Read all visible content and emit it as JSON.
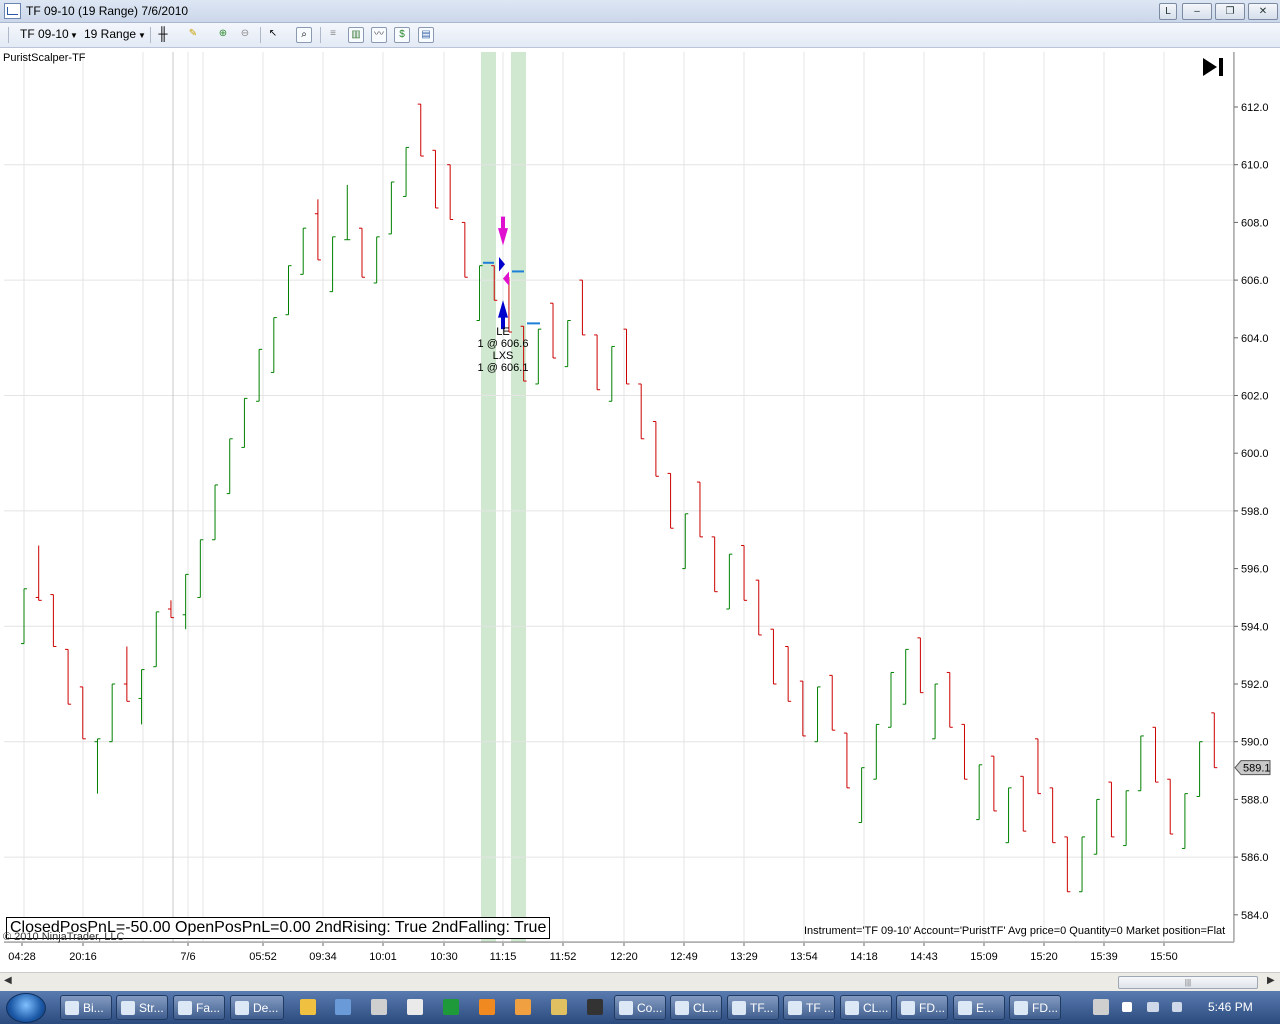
{
  "window": {
    "title": "TF 09-10 (19 Range)  7/6/2010",
    "buttons": [
      "L",
      "–",
      "❐",
      "✕"
    ]
  },
  "toolbar": {
    "instrument": "TF 09-10",
    "period": "19 Range"
  },
  "chart": {
    "panel_label": "PuristScalper-TF",
    "summary": "ClosedPosPnL=-50.00 OpenPosPnL=0.00 2ndRising: True 2ndFalling: True",
    "copyright": "© 2010 NinjaTrader, LLC",
    "instrument_info": "Instrument='TF 09-10' Account='PuristTF' Avg price=0 Quantity=0 Market position=Flat",
    "current_price": "589.1",
    "trade_labels": [
      "LE",
      "1 @ 606.6",
      "LXS",
      "1 @ 606.1"
    ]
  },
  "chart_data": {
    "type": "bar",
    "style": "OHLC range bars",
    "ylim": [
      583.5,
      613.5
    ],
    "y_ticks": [
      "612.0",
      "610.0",
      "608.0",
      "606.0",
      "604.0",
      "602.0",
      "600.0",
      "598.0",
      "596.0",
      "594.0",
      "592.0",
      "590.0",
      "588.0",
      "586.0",
      "584.0"
    ],
    "x_labels": [
      "04:28",
      "20:16",
      "7/6",
      "05:52",
      "09:34",
      "10:01",
      "10:30",
      "11:15",
      "11:52",
      "12:20",
      "12:49",
      "13:29",
      "13:54",
      "14:18",
      "14:43",
      "15:09",
      "15:20",
      "15:39",
      "15:50"
    ],
    "up_color": "#008000",
    "down_color": "#cc0000",
    "bars": [
      {
        "o": 593.4,
        "h": 595.3,
        "l": 593.4,
        "c": 595.3
      },
      {
        "o": 595.0,
        "h": 596.8,
        "l": 594.9,
        "c": 594.9
      },
      {
        "o": 595.1,
        "h": 595.1,
        "l": 593.3,
        "c": 593.3
      },
      {
        "o": 593.2,
        "h": 593.2,
        "l": 591.3,
        "c": 591.3
      },
      {
        "o": 591.9,
        "h": 591.9,
        "l": 590.1,
        "c": 590.1
      },
      {
        "o": 590.0,
        "h": 590.1,
        "l": 588.2,
        "c": 590.1
      },
      {
        "o": 590.0,
        "h": 592.0,
        "l": 590.0,
        "c": 592.0
      },
      {
        "o": 592.0,
        "h": 593.3,
        "l": 591.4,
        "c": 591.4
      },
      {
        "o": 591.5,
        "h": 592.5,
        "l": 590.6,
        "c": 592.5
      },
      {
        "o": 592.6,
        "h": 594.5,
        "l": 592.6,
        "c": 594.5
      },
      {
        "o": 594.6,
        "h": 594.9,
        "l": 594.3,
        "c": 594.3
      },
      {
        "o": 594.4,
        "h": 595.8,
        "l": 593.9,
        "c": 595.8
      },
      {
        "o": 595.0,
        "h": 597.0,
        "l": 595.0,
        "c": 597.0
      },
      {
        "o": 597.0,
        "h": 598.9,
        "l": 597.0,
        "c": 598.9
      },
      {
        "o": 598.6,
        "h": 600.5,
        "l": 598.6,
        "c": 600.5
      },
      {
        "o": 600.2,
        "h": 601.9,
        "l": 600.2,
        "c": 601.9
      },
      {
        "o": 601.8,
        "h": 603.6,
        "l": 601.8,
        "c": 603.6
      },
      {
        "o": 602.8,
        "h": 604.7,
        "l": 602.8,
        "c": 604.7
      },
      {
        "o": 604.8,
        "h": 606.5,
        "l": 604.8,
        "c": 606.5
      },
      {
        "o": 606.2,
        "h": 607.8,
        "l": 606.2,
        "c": 607.8
      },
      {
        "o": 608.3,
        "h": 608.8,
        "l": 606.7,
        "c": 606.7
      },
      {
        "o": 605.6,
        "h": 607.5,
        "l": 605.6,
        "c": 607.5
      },
      {
        "o": 607.4,
        "h": 609.3,
        "l": 607.4,
        "c": 607.4
      },
      {
        "o": 607.8,
        "h": 607.8,
        "l": 606.1,
        "c": 606.1
      },
      {
        "o": 605.9,
        "h": 607.5,
        "l": 605.9,
        "c": 607.5
      },
      {
        "o": 607.6,
        "h": 609.4,
        "l": 607.6,
        "c": 609.4
      },
      {
        "o": 608.9,
        "h": 610.6,
        "l": 608.9,
        "c": 610.6
      },
      {
        "o": 612.1,
        "h": 612.1,
        "l": 610.3,
        "c": 610.3
      },
      {
        "o": 610.5,
        "h": 610.5,
        "l": 608.5,
        "c": 608.5
      },
      {
        "o": 610.0,
        "h": 610.0,
        "l": 608.1,
        "c": 608.1
      },
      {
        "o": 608.0,
        "h": 608.0,
        "l": 606.1,
        "c": 606.1
      },
      {
        "o": 604.6,
        "h": 606.5,
        "l": 604.6,
        "c": 606.5
      },
      {
        "o": 606.5,
        "h": 606.5,
        "l": 605.3,
        "c": 605.3
      },
      {
        "o": 606.1,
        "h": 606.1,
        "l": 604.2,
        "c": 604.2
      },
      {
        "o": 604.4,
        "h": 604.4,
        "l": 602.5,
        "c": 602.5
      },
      {
        "o": 602.4,
        "h": 604.3,
        "l": 602.4,
        "c": 604.3
      },
      {
        "o": 605.2,
        "h": 605.2,
        "l": 603.3,
        "c": 603.3
      },
      {
        "o": 603.0,
        "h": 604.6,
        "l": 603.0,
        "c": 604.6
      },
      {
        "o": 606.0,
        "h": 606.0,
        "l": 604.1,
        "c": 604.1
      },
      {
        "o": 604.1,
        "h": 604.1,
        "l": 602.2,
        "c": 602.2
      },
      {
        "o": 601.8,
        "h": 603.7,
        "l": 601.8,
        "c": 603.7
      },
      {
        "o": 604.3,
        "h": 604.3,
        "l": 602.4,
        "c": 602.4
      },
      {
        "o": 602.4,
        "h": 602.4,
        "l": 600.5,
        "c": 600.5
      },
      {
        "o": 601.1,
        "h": 601.1,
        "l": 599.2,
        "c": 599.2
      },
      {
        "o": 599.3,
        "h": 599.3,
        "l": 597.4,
        "c": 597.4
      },
      {
        "o": 596.0,
        "h": 597.9,
        "l": 596.0,
        "c": 597.9
      },
      {
        "o": 599.0,
        "h": 599.0,
        "l": 597.1,
        "c": 597.1
      },
      {
        "o": 597.1,
        "h": 597.1,
        "l": 595.2,
        "c": 595.2
      },
      {
        "o": 594.6,
        "h": 596.5,
        "l": 594.6,
        "c": 596.5
      },
      {
        "o": 596.8,
        "h": 596.8,
        "l": 594.9,
        "c": 594.9
      },
      {
        "o": 595.6,
        "h": 595.6,
        "l": 593.7,
        "c": 593.7
      },
      {
        "o": 593.9,
        "h": 593.9,
        "l": 592.0,
        "c": 592.0
      },
      {
        "o": 593.3,
        "h": 593.3,
        "l": 591.4,
        "c": 591.4
      },
      {
        "o": 592.1,
        "h": 592.1,
        "l": 590.2,
        "c": 590.2
      },
      {
        "o": 590.0,
        "h": 591.9,
        "l": 590.0,
        "c": 591.9
      },
      {
        "o": 592.3,
        "h": 592.3,
        "l": 590.4,
        "c": 590.4
      },
      {
        "o": 590.3,
        "h": 590.3,
        "l": 588.4,
        "c": 588.4
      },
      {
        "o": 587.2,
        "h": 589.1,
        "l": 587.2,
        "c": 589.1
      },
      {
        "o": 588.7,
        "h": 590.6,
        "l": 588.7,
        "c": 590.6
      },
      {
        "o": 590.5,
        "h": 592.4,
        "l": 590.5,
        "c": 592.4
      },
      {
        "o": 591.3,
        "h": 593.2,
        "l": 591.3,
        "c": 593.2
      },
      {
        "o": 593.6,
        "h": 593.6,
        "l": 591.7,
        "c": 591.7
      },
      {
        "o": 590.1,
        "h": 592.0,
        "l": 590.1,
        "c": 592.0
      },
      {
        "o": 592.4,
        "h": 592.4,
        "l": 590.5,
        "c": 590.5
      },
      {
        "o": 590.6,
        "h": 590.6,
        "l": 588.7,
        "c": 588.7
      },
      {
        "o": 587.3,
        "h": 589.2,
        "l": 587.3,
        "c": 589.2
      },
      {
        "o": 589.5,
        "h": 589.5,
        "l": 587.6,
        "c": 587.6
      },
      {
        "o": 586.5,
        "h": 588.4,
        "l": 586.5,
        "c": 588.4
      },
      {
        "o": 588.8,
        "h": 588.8,
        "l": 586.9,
        "c": 586.9
      },
      {
        "o": 590.1,
        "h": 590.1,
        "l": 588.2,
        "c": 588.2
      },
      {
        "o": 588.4,
        "h": 588.4,
        "l": 586.5,
        "c": 586.5
      },
      {
        "o": 586.7,
        "h": 586.7,
        "l": 584.8,
        "c": 584.8
      },
      {
        "o": 584.8,
        "h": 586.7,
        "l": 584.8,
        "c": 586.7
      },
      {
        "o": 586.1,
        "h": 588.0,
        "l": 586.1,
        "c": 588.0
      },
      {
        "o": 588.6,
        "h": 588.6,
        "l": 586.7,
        "c": 586.7
      },
      {
        "o": 586.4,
        "h": 588.3,
        "l": 586.4,
        "c": 588.3
      },
      {
        "o": 588.3,
        "h": 590.2,
        "l": 588.3,
        "c": 590.2
      },
      {
        "o": 590.5,
        "h": 590.5,
        "l": 588.6,
        "c": 588.6
      },
      {
        "o": 588.7,
        "h": 588.7,
        "l": 586.8,
        "c": 586.8
      },
      {
        "o": 586.3,
        "h": 588.2,
        "l": 586.3,
        "c": 588.2
      },
      {
        "o": 588.1,
        "h": 590.0,
        "l": 588.1,
        "c": 590.0
      },
      {
        "o": 591.0,
        "h": 591.0,
        "l": 589.1,
        "c": 589.1
      }
    ]
  },
  "taskbar": {
    "items": [
      "Bi...",
      "Str...",
      "Fa...",
      "De...",
      "Co...",
      "CL...",
      "TF...",
      "TF ...",
      "CL...",
      "FD...",
      "E...",
      "FD..."
    ],
    "clock": "5:46 PM"
  }
}
